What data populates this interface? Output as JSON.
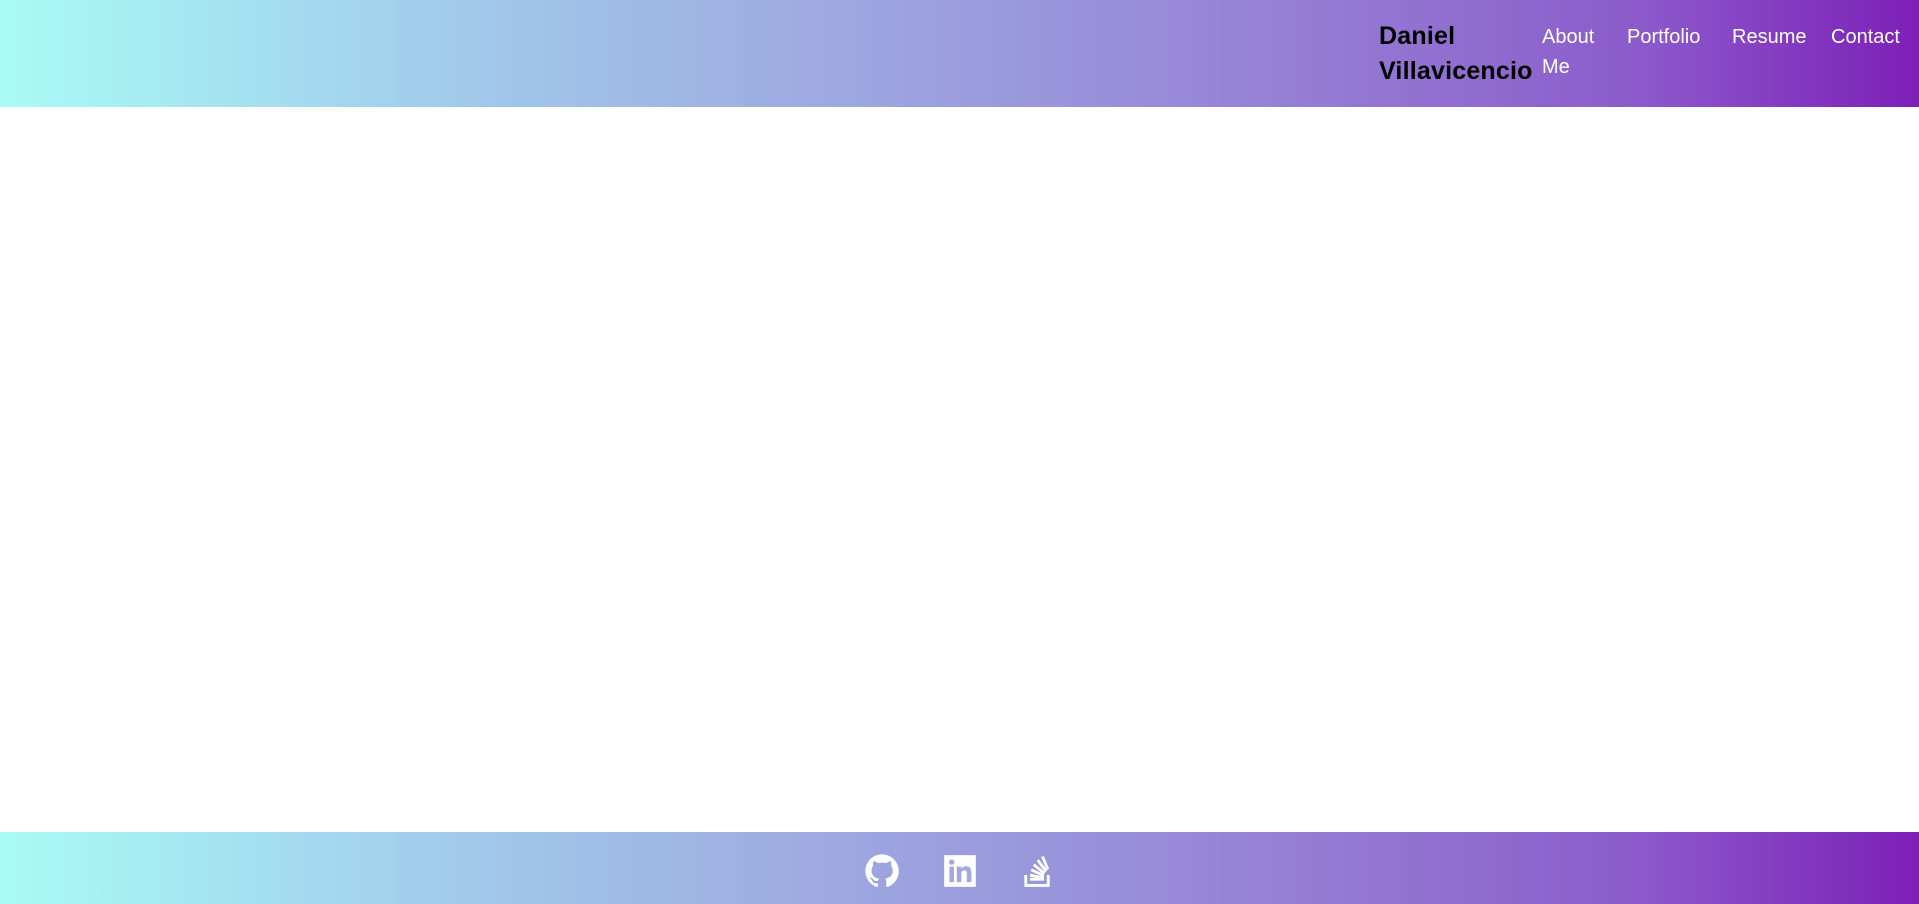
{
  "header": {
    "brand": "Daniel Villavicencio",
    "nav": {
      "about": "About Me",
      "portfolio": "Portfolio",
      "resume": "Resume",
      "contact": "Contact"
    }
  },
  "footer": {
    "icons": [
      "github-icon",
      "linkedin-icon",
      "stackoverflow-icon"
    ]
  },
  "colors": {
    "gradient_start": "#a8fbf5",
    "gradient_end": "#7d1fb8",
    "nav_text": "#ffffff",
    "brand_text": "#000000"
  }
}
